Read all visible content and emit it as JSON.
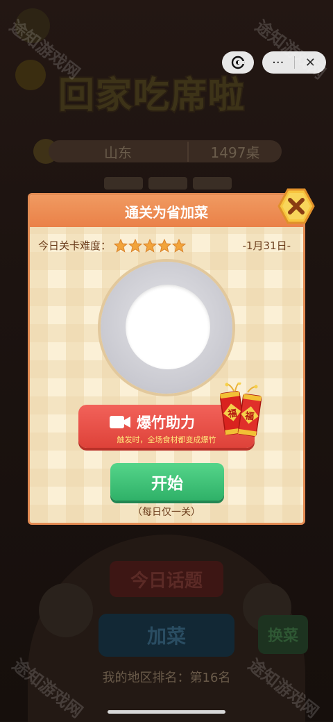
{
  "background": {
    "game_title": "回家吃席啦",
    "region_name": "山东",
    "region_count": "1497桌",
    "today_topic_label": "今日话题",
    "add_dish_label": "加菜",
    "swap_dish_label": "换菜",
    "rank_text": "我的地区排名：第16名"
  },
  "capsule": {
    "more_glyph": "···",
    "close_glyph": "✕"
  },
  "modal": {
    "title": "通关为省加菜",
    "difficulty_label": "今日关卡难度：",
    "difficulty_stars": 5,
    "date": "-1月31日-",
    "firecracker_label": "爆竹助力",
    "firecracker_desc": "触发时，全场食材都变成爆竹",
    "firecracker_char": "福",
    "start_label": "开始",
    "daily_note": "（每日仅一关）"
  },
  "watermark": "途知游戏网",
  "colors": {
    "header": "#ea8148",
    "red_button": "#de4239",
    "green_button": "#2fb168",
    "star": "#f2a43a"
  }
}
